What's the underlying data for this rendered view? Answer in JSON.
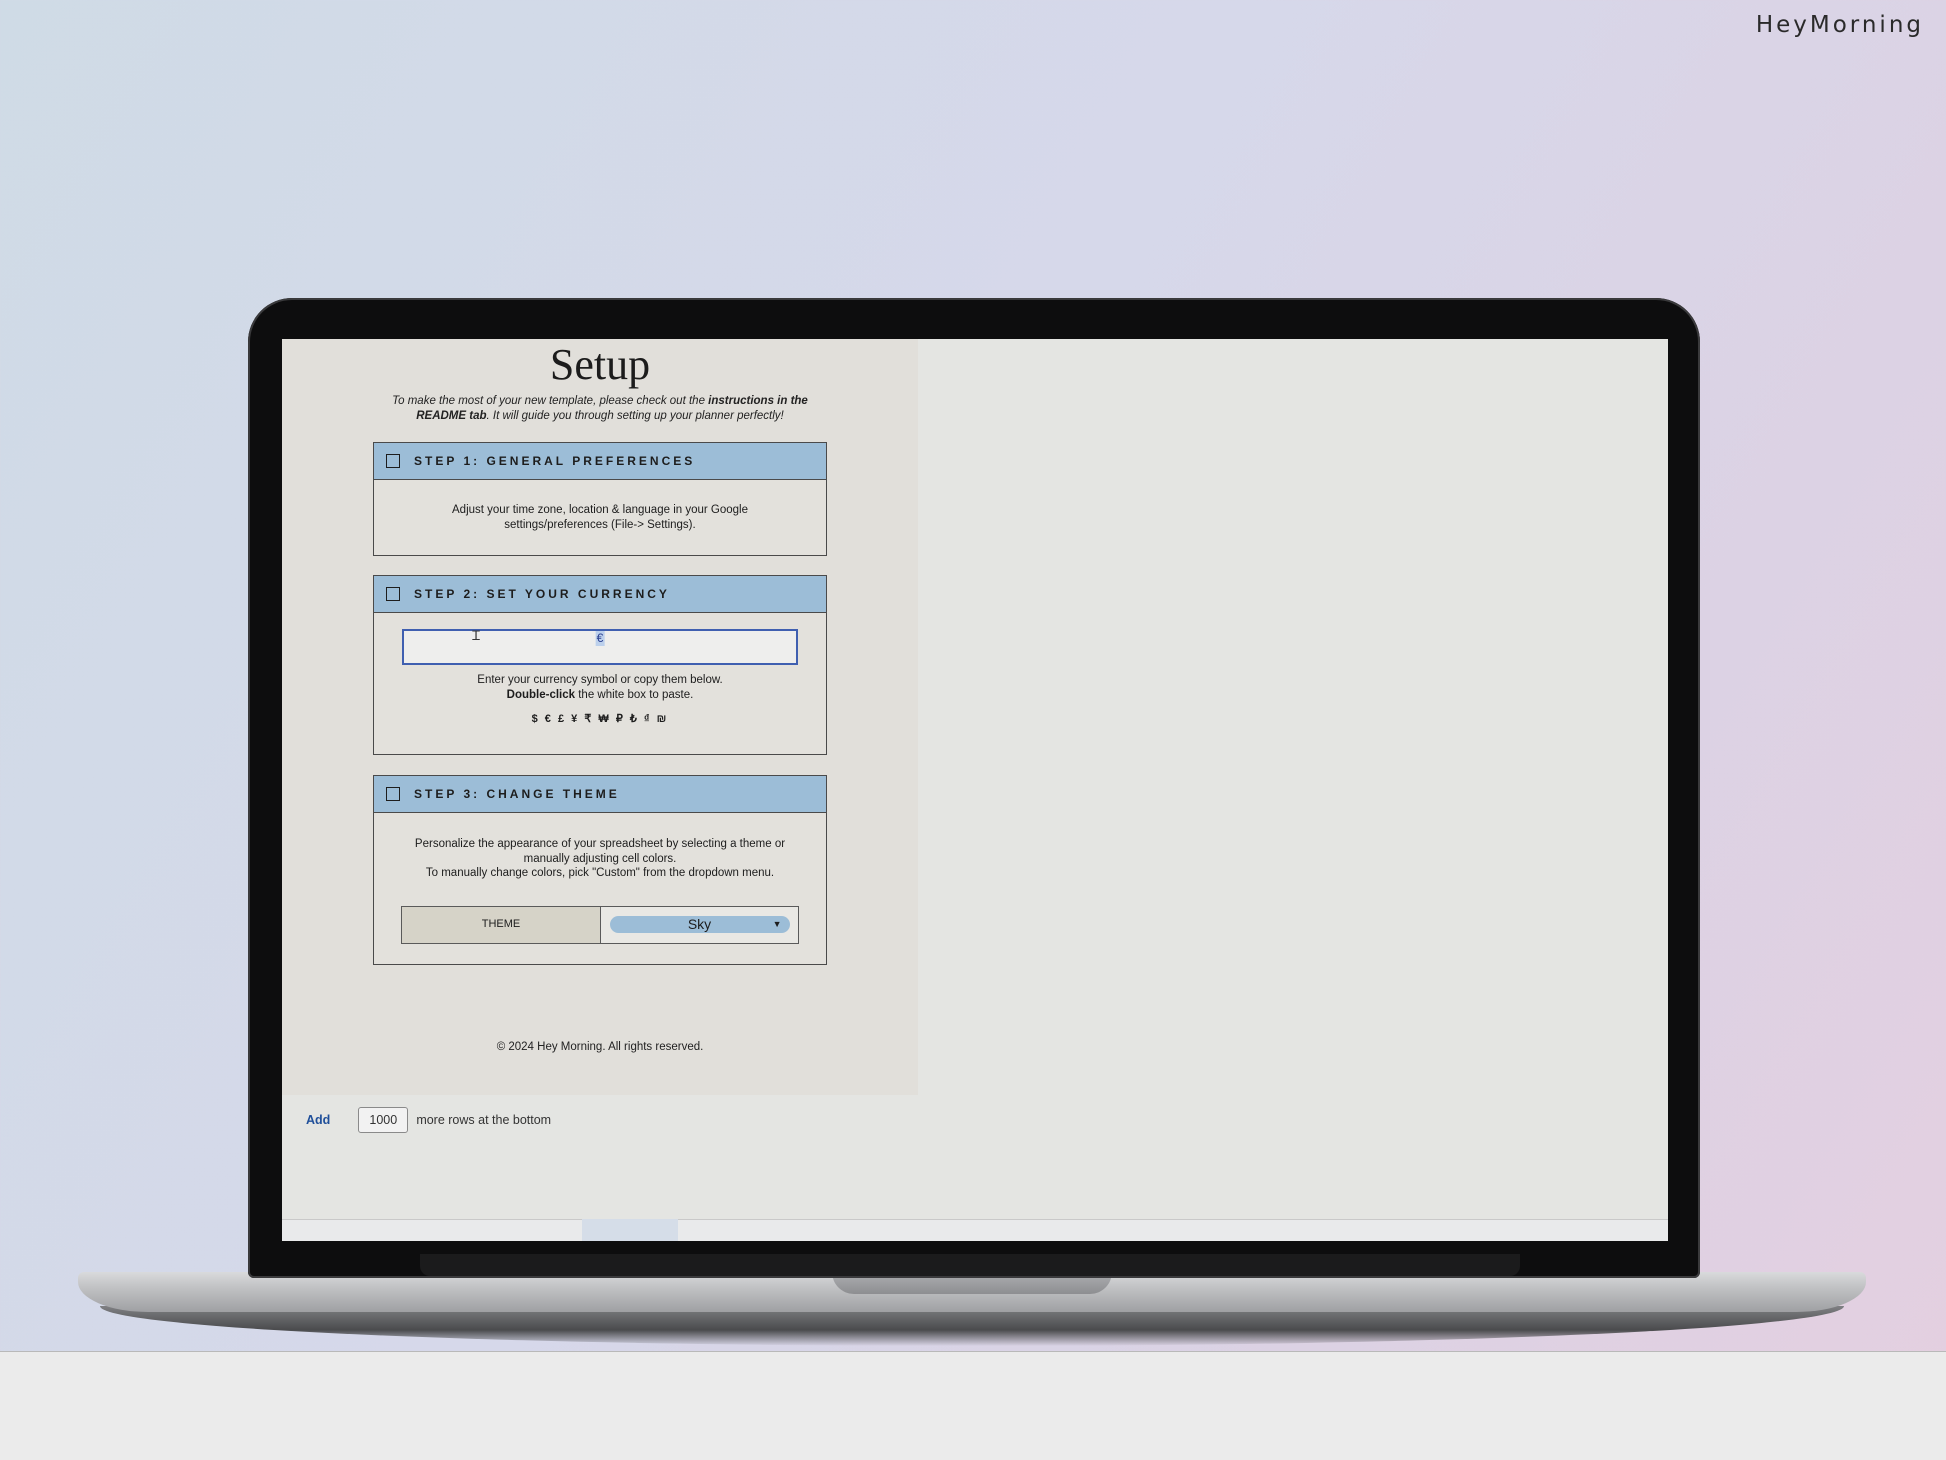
{
  "brand": "HeyMorning",
  "sheet": {
    "title": "Setup",
    "intro_part1": "To make the most of your new template, please check out the ",
    "intro_bold": "instructions in the README tab",
    "intro_part2": ". It will guide you through setting up your planner perfectly!",
    "step1": {
      "title": "STEP 1: GENERAL PREFERENCES",
      "line1": "Adjust your time zone, location & language in your Google",
      "line2": "settings/preferences (File-> Settings)."
    },
    "step2": {
      "title": "STEP 2: SET YOUR CURRENCY",
      "currency_value": "€",
      "line1": "Enter your currency symbol or copy them below.",
      "line2_bold": "Double-click",
      "line2_rest": " the white box to paste.",
      "symbols": "$ € £ ¥ ₹ ₩ ₽ ₺ ₫ ₪"
    },
    "step3": {
      "title": "STEP 3: CHANGE THEME",
      "line1": "Personalize the appearance of your spreadsheet by selecting a theme or",
      "line2": "manually adjusting cell colors.",
      "line3": "To manually change colors, pick \"Custom\" from the dropdown menu.",
      "theme_label": "THEME",
      "theme_value": "Sky"
    },
    "copyright": "© 2024 Hey Morning. All rights reserved."
  },
  "add_rows": {
    "add_label": "Add",
    "count": "1000",
    "suffix": "more rows at the bottom"
  },
  "colors": {
    "step_header": "#9cbdd7",
    "sheet_bg": "#e1dfda",
    "selection_border": "#3f5fb0"
  }
}
